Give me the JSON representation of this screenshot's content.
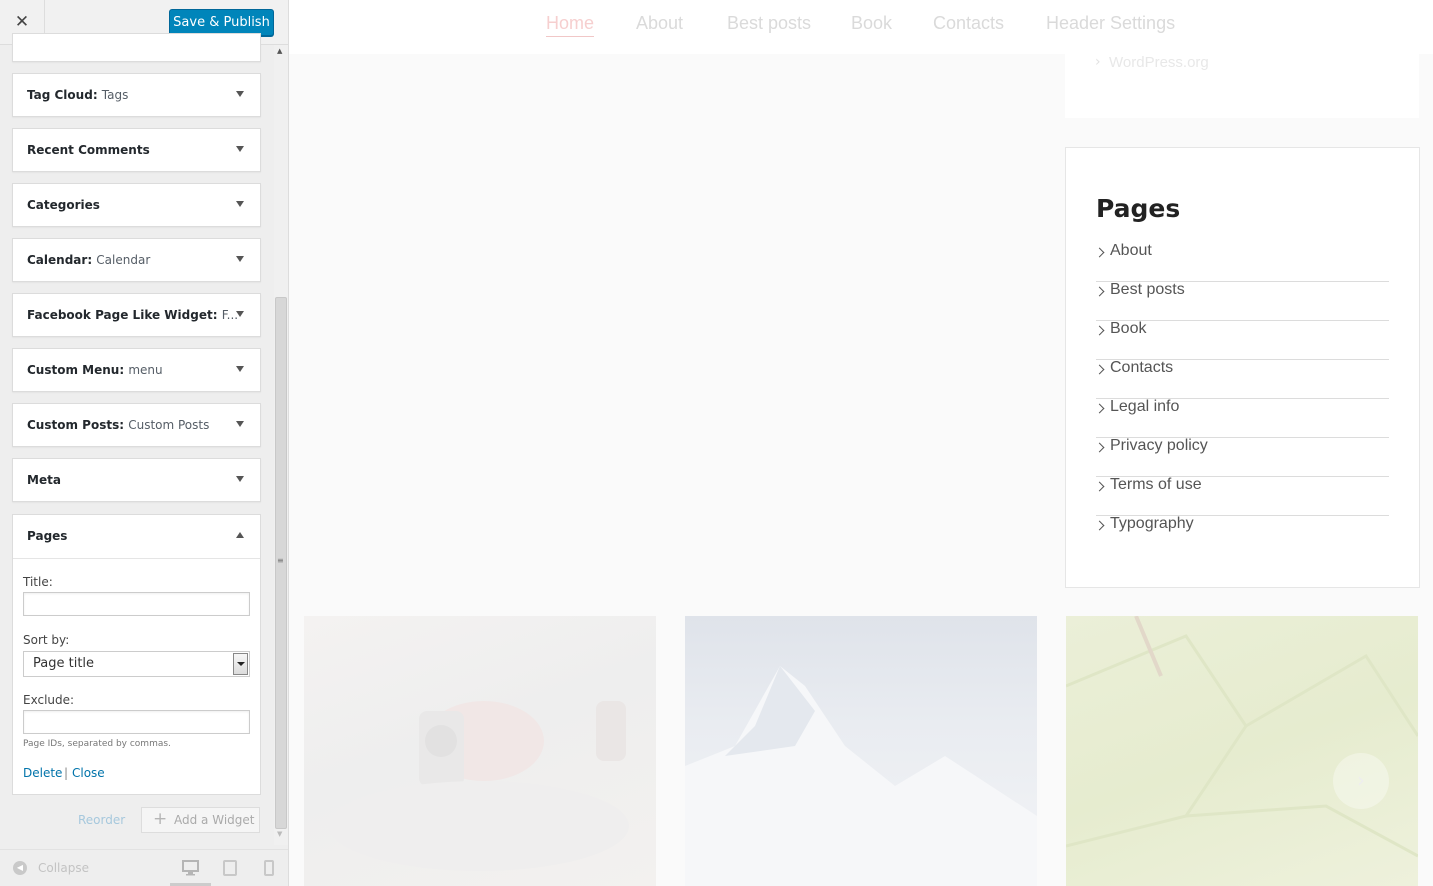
{
  "sidebar": {
    "close_icon": "close-icon",
    "publish_label": "Save & Publish",
    "widgets": [
      {
        "title": "Tag Cloud",
        "subtitle": "Tags"
      },
      {
        "title": "Recent Comments",
        "subtitle": ""
      },
      {
        "title": "Categories",
        "subtitle": ""
      },
      {
        "title": "Calendar",
        "subtitle": "Calendar"
      },
      {
        "title": "Facebook Page Like Widget",
        "subtitle": "F..."
      },
      {
        "title": "Custom Menu",
        "subtitle": "menu"
      },
      {
        "title": "Custom Posts",
        "subtitle": "Custom Posts"
      },
      {
        "title": "Meta",
        "subtitle": ""
      }
    ],
    "pages_widget": {
      "title": "Pages",
      "title_label": "Title:",
      "title_value": "",
      "sort_label": "Sort by:",
      "sort_value": "Page title",
      "exclude_label": "Exclude:",
      "exclude_value": "",
      "help_text": "Page IDs, separated by commas.",
      "delete_label": "Delete",
      "separator": "|",
      "close_label": "Close"
    },
    "reorder_label": "Reorder",
    "add_widget_label": "Add a Widget",
    "collapse_label": "Collapse"
  },
  "preview": {
    "nav": [
      "Home",
      "About",
      "Best posts",
      "Book",
      "Contacts",
      "Header Settings"
    ],
    "active_nav": "Home",
    "prev_widget_link": "WordPress.org",
    "pages_heading": "Pages",
    "pages": [
      "About",
      "Best posts",
      "Book",
      "Contacts",
      "Legal info",
      "Privacy policy",
      "Terms of use",
      "Typography"
    ],
    "slider_next": "›"
  },
  "colors": {
    "accent": "#0085ba",
    "link": "#0073aa",
    "nav_active": "#f6cfcf"
  }
}
